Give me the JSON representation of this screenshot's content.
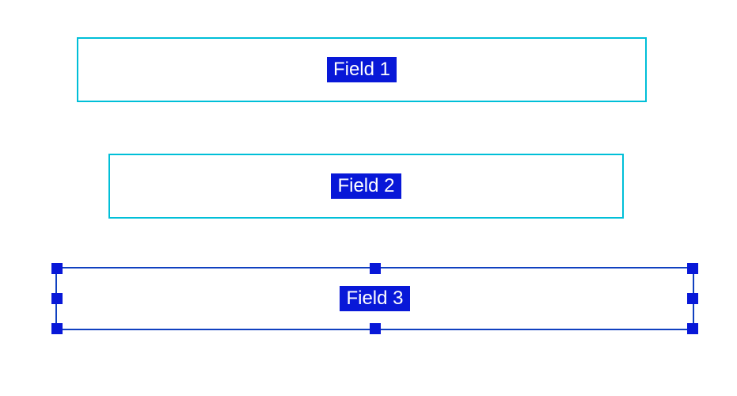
{
  "fields": {
    "field1": {
      "label": "Field 1"
    },
    "field2": {
      "label": "Field 2"
    },
    "field3": {
      "label": "Field 3"
    }
  },
  "colors": {
    "unselected_border": "#00BFD8",
    "selected_border": "#1040C0",
    "label_bg": "#0818D8",
    "label_fg": "#FFFFFF"
  }
}
